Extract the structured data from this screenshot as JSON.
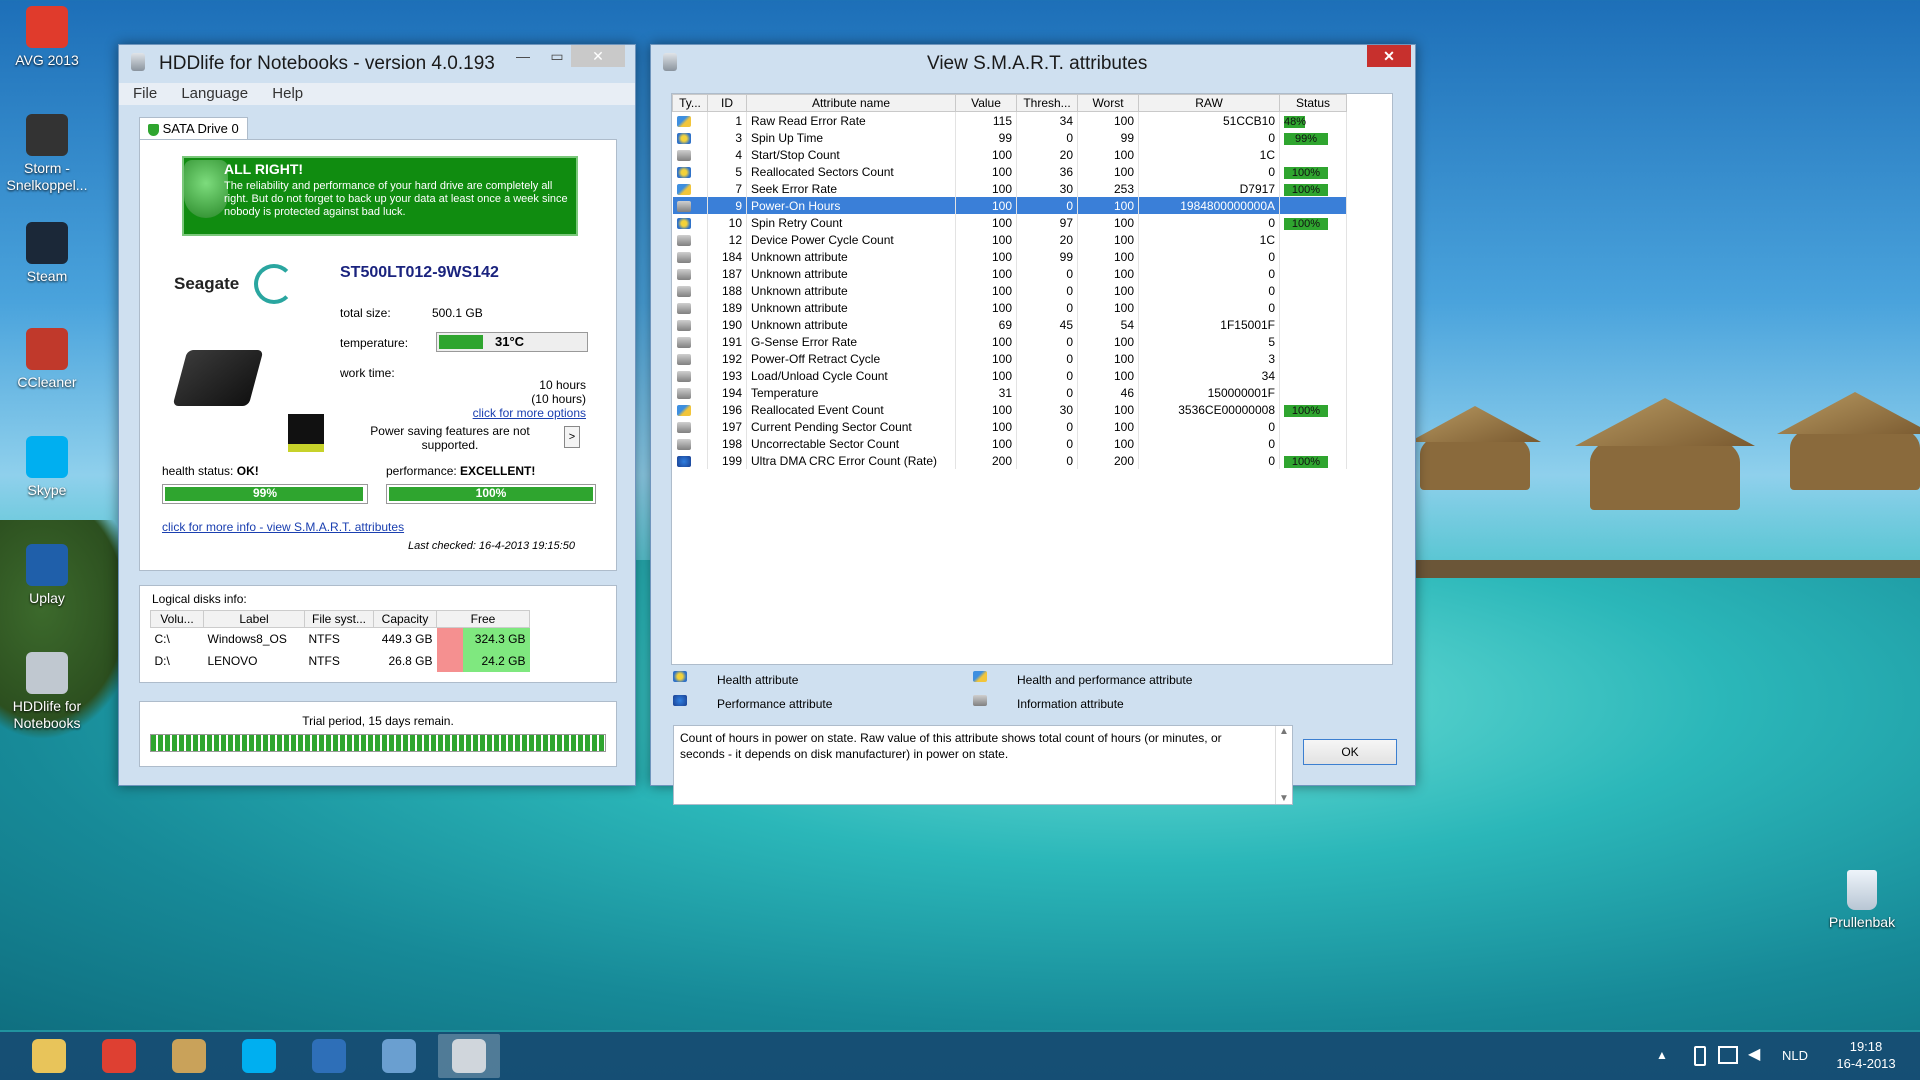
{
  "desktop": {
    "icons": [
      {
        "label": "AVG 2013",
        "color": "#e03b2c"
      },
      {
        "label": "Storm - Snelkoppel...",
        "color": "#333333"
      },
      {
        "label": "Steam",
        "color": "#1b2838"
      },
      {
        "label": "CCleaner",
        "color": "#c0392b"
      },
      {
        "label": "Skype",
        "color": "#00aff0"
      },
      {
        "label": "Uplay",
        "color": "#1f5faa"
      },
      {
        "label": "HDDlife for Notebooks",
        "color": "#c0c8d0"
      }
    ],
    "recycle_bin": "Prullenbak"
  },
  "hddlife": {
    "title": "HDDlife for Notebooks - version 4.0.193",
    "menu": [
      "File",
      "Language",
      "Help"
    ],
    "tab": "SATA Drive 0",
    "banner_title": "ALL RIGHT!",
    "banner_text": "The reliability and performance of your hard drive are completely all right. But do not forget to back up your data at least once a week since nobody is protected against bad luck.",
    "brand": "Seagate",
    "model": "ST500LT012-9WS142",
    "total_size_label": "total size:",
    "total_size": "500.1 GB",
    "temperature_label": "temperature:",
    "temperature": "31°C",
    "temperature_fraction": 0.3,
    "work_time_label": "work time:",
    "work_time_1": "10 hours",
    "work_time_2": "(10 hours)",
    "more_options": "click for more options",
    "power_text": "Power saving features are not supported.",
    "power_button": ">",
    "health_label": "health status:",
    "health_value": "OK!",
    "health_percent": "99%",
    "health_fraction": 0.99,
    "perf_label": "performance:",
    "perf_value": "EXCELLENT!",
    "perf_percent": "100%",
    "perf_fraction": 1.0,
    "smart_link": "click for more info - view S.M.A.R.T. attributes",
    "last_checked": "Last checked:  16-4-2013 19:15:50",
    "logical_title": "Logical disks info:",
    "logical_headers": [
      "Volu...",
      "Label",
      "File syst...",
      "Capacity",
      "Free"
    ],
    "logical_rows": [
      {
        "vol": "C:\\",
        "label": "Windows8_OS",
        "fs": "NTFS",
        "cap": "449.3 GB",
        "free": "324.3 GB",
        "free_color": "#f59090"
      },
      {
        "vol": "D:\\",
        "label": "LENOVO",
        "fs": "NTFS",
        "cap": "26.8 GB",
        "free": "24.2 GB",
        "free_color": "#f59090"
      }
    ],
    "trial_text": "Trial period, 15 days remain."
  },
  "smart": {
    "title": "View S.M.A.R.T. attributes",
    "headers": [
      "Ty...",
      "ID",
      "Attribute name",
      "Value",
      "Thresh...",
      "Worst",
      "RAW",
      "Status"
    ],
    "rows": [
      {
        "type": "hp",
        "id": "1",
        "name": "Raw Read Error Rate",
        "value": "115",
        "thresh": "34",
        "worst": "100",
        "raw": "51CCB10",
        "status": "48%",
        "status_fraction": 0.48
      },
      {
        "type": "health",
        "id": "3",
        "name": "Spin Up Time",
        "value": "99",
        "thresh": "0",
        "worst": "99",
        "raw": "0",
        "status": "99%",
        "status_fraction": 0.99
      },
      {
        "type": "info",
        "id": "4",
        "name": "Start/Stop Count",
        "value": "100",
        "thresh": "20",
        "worst": "100",
        "raw": "1C",
        "status": "",
        "status_fraction": 0
      },
      {
        "type": "health",
        "id": "5",
        "name": "Reallocated Sectors Count",
        "value": "100",
        "thresh": "36",
        "worst": "100",
        "raw": "0",
        "status": "100%",
        "status_fraction": 1
      },
      {
        "type": "hp",
        "id": "7",
        "name": "Seek Error Rate",
        "value": "100",
        "thresh": "30",
        "worst": "253",
        "raw": "D7917",
        "status": "100%",
        "status_fraction": 1
      },
      {
        "type": "info",
        "id": "9",
        "name": "Power-On Hours",
        "value": "100",
        "thresh": "0",
        "worst": "100",
        "raw": "1984800000000A",
        "status": "",
        "status_fraction": 0,
        "selected": true
      },
      {
        "type": "health",
        "id": "10",
        "name": "Spin Retry Count",
        "value": "100",
        "thresh": "97",
        "worst": "100",
        "raw": "0",
        "status": "100%",
        "status_fraction": 1
      },
      {
        "type": "info",
        "id": "12",
        "name": "Device Power Cycle Count",
        "value": "100",
        "thresh": "20",
        "worst": "100",
        "raw": "1C",
        "status": "",
        "status_fraction": 0
      },
      {
        "type": "info",
        "id": "184",
        "name": "Unknown attribute",
        "value": "100",
        "thresh": "99",
        "worst": "100",
        "raw": "0",
        "status": "",
        "status_fraction": 0
      },
      {
        "type": "info",
        "id": "187",
        "name": "Unknown attribute",
        "value": "100",
        "thresh": "0",
        "worst": "100",
        "raw": "0",
        "status": "",
        "status_fraction": 0
      },
      {
        "type": "info",
        "id": "188",
        "name": "Unknown attribute",
        "value": "100",
        "thresh": "0",
        "worst": "100",
        "raw": "0",
        "status": "",
        "status_fraction": 0
      },
      {
        "type": "info",
        "id": "189",
        "name": "Unknown attribute",
        "value": "100",
        "thresh": "0",
        "worst": "100",
        "raw": "0",
        "status": "",
        "status_fraction": 0
      },
      {
        "type": "info",
        "id": "190",
        "name": "Unknown attribute",
        "value": "69",
        "thresh": "45",
        "worst": "54",
        "raw": "1F15001F",
        "status": "",
        "status_fraction": 0
      },
      {
        "type": "info",
        "id": "191",
        "name": "G-Sense Error Rate",
        "value": "100",
        "thresh": "0",
        "worst": "100",
        "raw": "5",
        "status": "",
        "status_fraction": 0
      },
      {
        "type": "info",
        "id": "192",
        "name": "Power-Off Retract Cycle",
        "value": "100",
        "thresh": "0",
        "worst": "100",
        "raw": "3",
        "status": "",
        "status_fraction": 0
      },
      {
        "type": "info",
        "id": "193",
        "name": "Load/Unload Cycle Count",
        "value": "100",
        "thresh": "0",
        "worst": "100",
        "raw": "34",
        "status": "",
        "status_fraction": 0
      },
      {
        "type": "info",
        "id": "194",
        "name": "Temperature",
        "value": "31",
        "thresh": "0",
        "worst": "46",
        "raw": "150000001F",
        "status": "",
        "status_fraction": 0
      },
      {
        "type": "hp",
        "id": "196",
        "name": "Reallocated Event Count",
        "value": "100",
        "thresh": "30",
        "worst": "100",
        "raw": "3536CE00000008",
        "status": "100%",
        "status_fraction": 1
      },
      {
        "type": "info",
        "id": "197",
        "name": "Current Pending Sector Count",
        "value": "100",
        "thresh": "0",
        "worst": "100",
        "raw": "0",
        "status": "",
        "status_fraction": 0
      },
      {
        "type": "info",
        "id": "198",
        "name": "Uncorrectable Sector Count",
        "value": "100",
        "thresh": "0",
        "worst": "100",
        "raw": "0",
        "status": "",
        "status_fraction": 0
      },
      {
        "type": "perf",
        "id": "199",
        "name": "Ultra DMA CRC Error Count (Rate)",
        "value": "200",
        "thresh": "0",
        "worst": "200",
        "raw": "0",
        "status": "100%",
        "status_fraction": 1
      }
    ],
    "legend": {
      "health": "Health attribute",
      "hp": "Health and performance attribute",
      "perf": "Performance attribute",
      "info": "Information attribute"
    },
    "description": "Count of hours in power on state. Raw value of this attribute shows total count of hours (or minutes, or seconds - it depends on disk manufacturer) in power on state.",
    "ok_button": "OK"
  },
  "taskbar": {
    "apps": [
      {
        "name": "file-explorer",
        "color": "#e8c45a"
      },
      {
        "name": "chrome",
        "color": "#de4032"
      },
      {
        "name": "libraries",
        "color": "#c9a25a"
      },
      {
        "name": "skype",
        "color": "#00aff0"
      },
      {
        "name": "uplay",
        "color": "#2e6fb8"
      },
      {
        "name": "control-panel",
        "color": "#6a9fd0"
      },
      {
        "name": "hddlife",
        "color": "#d0d6dc"
      }
    ],
    "language": "NLD",
    "time": "19:18",
    "date": "16-4-2013"
  }
}
